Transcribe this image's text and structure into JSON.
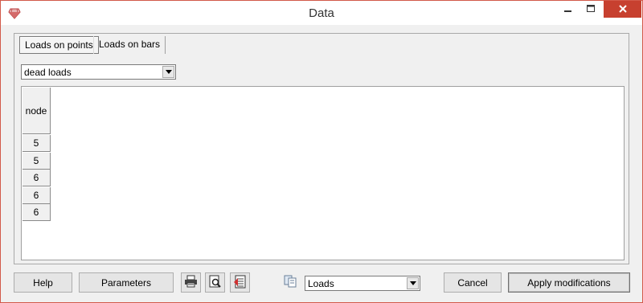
{
  "window": {
    "title": "Data"
  },
  "tabs": [
    {
      "label": "Loads on points",
      "active": true
    },
    {
      "label": "Loads on bars",
      "active": false
    }
  ],
  "load_case": {
    "selected": "dead loads"
  },
  "table": {
    "header": "node",
    "rows": [
      "5",
      "5",
      "6",
      "6",
      "6"
    ]
  },
  "footer": {
    "help_label": "Help",
    "parameters_label": "Parameters",
    "view_selected": "Loads",
    "cancel_label": "Cancel",
    "apply_label": "Apply modifications"
  },
  "icons": {
    "app": "gem-icon",
    "print": "printer-icon",
    "preview": "print-preview-icon",
    "report": "report-icon",
    "copy": "copy-icon"
  },
  "colors": {
    "close_button": "#c7402f",
    "window_border": "#d25a4a"
  }
}
